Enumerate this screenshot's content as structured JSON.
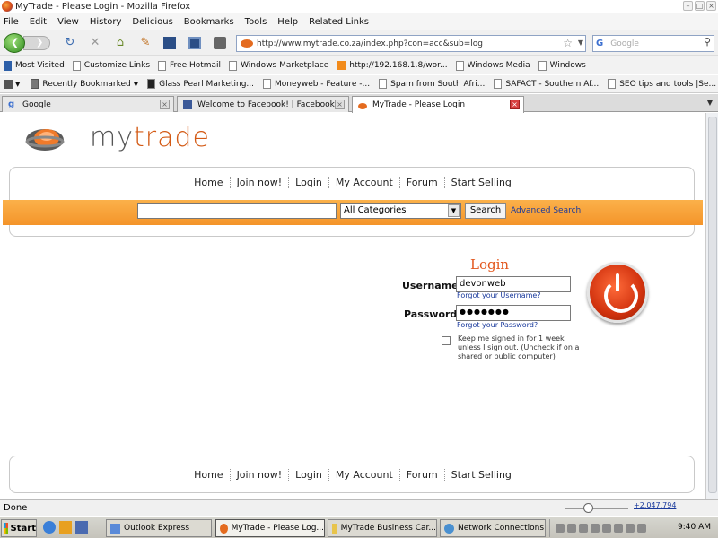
{
  "window": {
    "title": "MyTrade - Please Login - Mozilla Firefox"
  },
  "menu": [
    {
      "u": "F",
      "rest": "ile"
    },
    {
      "u": "E",
      "rest": "dit"
    },
    {
      "u": "V",
      "rest": "iew"
    },
    {
      "u": "",
      "rest": "Hi",
      "u2": "s",
      "rest2": "tory"
    },
    {
      "u": "D",
      "rest": "elicious"
    },
    {
      "u": "B",
      "rest": "ookmarks"
    },
    {
      "u": "T",
      "rest": "ools"
    },
    {
      "u": "H",
      "rest": "elp"
    },
    {
      "u": "R",
      "rest": "elated Links"
    }
  ],
  "menu_labels": [
    "File",
    "Edit",
    "View",
    "History",
    "Delicious",
    "Bookmarks",
    "Tools",
    "Help",
    "Related Links"
  ],
  "address": {
    "url": "http://www.mytrade.co.za/index.php?con=acc&sub=log"
  },
  "search": {
    "engine": "G",
    "placeholder": "Google"
  },
  "bookmarks": [
    "Most Visited",
    "Customize Links",
    "Free Hotmail",
    "Windows Marketplace",
    "http://192.168.1.8/wor...",
    "Windows Media",
    "Windows"
  ],
  "bookmarks2": [
    "Recently Bookmarked",
    "Glass Pearl Marketing...",
    "Moneyweb - Feature -...",
    "Spam from South Afri...",
    "SAFACT - Southern Af...",
    "SEO tips and tools |Se..."
  ],
  "tabs": [
    {
      "label": "Google"
    },
    {
      "label": "Welcome to Facebook! | Facebook"
    },
    {
      "label": "MyTrade - Please Login"
    }
  ],
  "site": {
    "logo_my": "my",
    "logo_trade": "trade",
    "nav": [
      "Home",
      "Join now!",
      "Login",
      "My Account",
      "Forum",
      "Start Selling"
    ],
    "search": {
      "category": "All Categories",
      "button": "Search",
      "advanced": "Advanced Search"
    },
    "login": {
      "title": "Login",
      "username_label": "Username",
      "username_value": "devonweb",
      "forgot_username": "Forgot your Username?",
      "password_label": "Password",
      "password_value": "●●●●●●●",
      "forgot_password": "Forgot your Password?",
      "keep_signed": "Keep me signed in for 1 week unless I sign out. (Uncheck if on a shared or public computer)"
    },
    "footer_nav": [
      "Home",
      "Join now!",
      "Login",
      "My Account",
      "Forum",
      "Start Selling"
    ]
  },
  "status": {
    "text": "Done",
    "zoom": "+2,047,794"
  },
  "taskbar": {
    "start": "Start",
    "tasks": [
      "Outlook Express",
      "MyTrade - Please Log...",
      "MyTrade Business Car...",
      "Network Connections"
    ],
    "clock": "9:40 AM"
  },
  "colors": {
    "accent": "#f4942a",
    "brand": "#d35a15",
    "link": "#1a3a9c"
  }
}
